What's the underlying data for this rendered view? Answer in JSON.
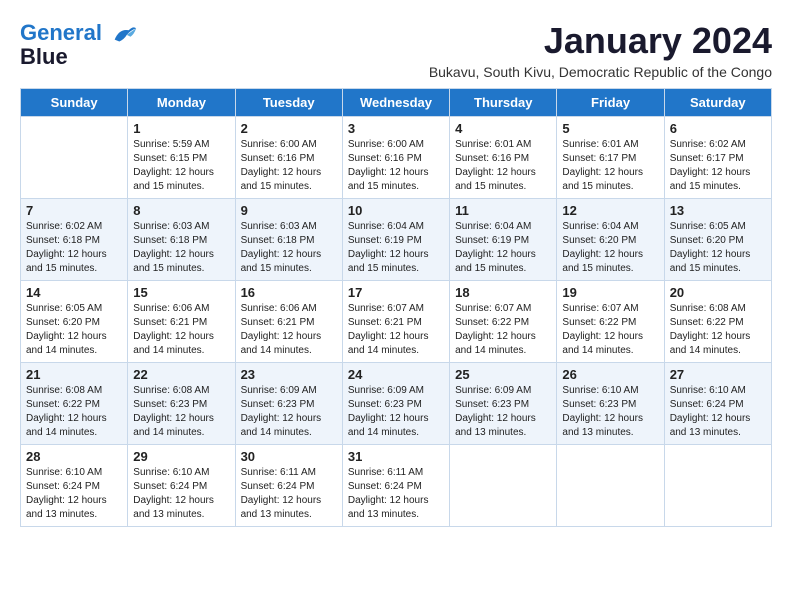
{
  "header": {
    "logo": {
      "line1": "General",
      "line2": "Blue"
    },
    "title": "January 2024",
    "subtitle": "Bukavu, South Kivu, Democratic Republic of the Congo"
  },
  "weekdays": [
    "Sunday",
    "Monday",
    "Tuesday",
    "Wednesday",
    "Thursday",
    "Friday",
    "Saturday"
  ],
  "weeks": [
    [
      {
        "day": "",
        "info": ""
      },
      {
        "day": "1",
        "info": "Sunrise: 5:59 AM\nSunset: 6:15 PM\nDaylight: 12 hours\nand 15 minutes."
      },
      {
        "day": "2",
        "info": "Sunrise: 6:00 AM\nSunset: 6:16 PM\nDaylight: 12 hours\nand 15 minutes."
      },
      {
        "day": "3",
        "info": "Sunrise: 6:00 AM\nSunset: 6:16 PM\nDaylight: 12 hours\nand 15 minutes."
      },
      {
        "day": "4",
        "info": "Sunrise: 6:01 AM\nSunset: 6:16 PM\nDaylight: 12 hours\nand 15 minutes."
      },
      {
        "day": "5",
        "info": "Sunrise: 6:01 AM\nSunset: 6:17 PM\nDaylight: 12 hours\nand 15 minutes."
      },
      {
        "day": "6",
        "info": "Sunrise: 6:02 AM\nSunset: 6:17 PM\nDaylight: 12 hours\nand 15 minutes."
      }
    ],
    [
      {
        "day": "7",
        "info": "Sunrise: 6:02 AM\nSunset: 6:18 PM\nDaylight: 12 hours\nand 15 minutes."
      },
      {
        "day": "8",
        "info": "Sunrise: 6:03 AM\nSunset: 6:18 PM\nDaylight: 12 hours\nand 15 minutes."
      },
      {
        "day": "9",
        "info": "Sunrise: 6:03 AM\nSunset: 6:18 PM\nDaylight: 12 hours\nand 15 minutes."
      },
      {
        "day": "10",
        "info": "Sunrise: 6:04 AM\nSunset: 6:19 PM\nDaylight: 12 hours\nand 15 minutes."
      },
      {
        "day": "11",
        "info": "Sunrise: 6:04 AM\nSunset: 6:19 PM\nDaylight: 12 hours\nand 15 minutes."
      },
      {
        "day": "12",
        "info": "Sunrise: 6:04 AM\nSunset: 6:20 PM\nDaylight: 12 hours\nand 15 minutes."
      },
      {
        "day": "13",
        "info": "Sunrise: 6:05 AM\nSunset: 6:20 PM\nDaylight: 12 hours\nand 15 minutes."
      }
    ],
    [
      {
        "day": "14",
        "info": "Sunrise: 6:05 AM\nSunset: 6:20 PM\nDaylight: 12 hours\nand 14 minutes."
      },
      {
        "day": "15",
        "info": "Sunrise: 6:06 AM\nSunset: 6:21 PM\nDaylight: 12 hours\nand 14 minutes."
      },
      {
        "day": "16",
        "info": "Sunrise: 6:06 AM\nSunset: 6:21 PM\nDaylight: 12 hours\nand 14 minutes."
      },
      {
        "day": "17",
        "info": "Sunrise: 6:07 AM\nSunset: 6:21 PM\nDaylight: 12 hours\nand 14 minutes."
      },
      {
        "day": "18",
        "info": "Sunrise: 6:07 AM\nSunset: 6:22 PM\nDaylight: 12 hours\nand 14 minutes."
      },
      {
        "day": "19",
        "info": "Sunrise: 6:07 AM\nSunset: 6:22 PM\nDaylight: 12 hours\nand 14 minutes."
      },
      {
        "day": "20",
        "info": "Sunrise: 6:08 AM\nSunset: 6:22 PM\nDaylight: 12 hours\nand 14 minutes."
      }
    ],
    [
      {
        "day": "21",
        "info": "Sunrise: 6:08 AM\nSunset: 6:22 PM\nDaylight: 12 hours\nand 14 minutes."
      },
      {
        "day": "22",
        "info": "Sunrise: 6:08 AM\nSunset: 6:23 PM\nDaylight: 12 hours\nand 14 minutes."
      },
      {
        "day": "23",
        "info": "Sunrise: 6:09 AM\nSunset: 6:23 PM\nDaylight: 12 hours\nand 14 minutes."
      },
      {
        "day": "24",
        "info": "Sunrise: 6:09 AM\nSunset: 6:23 PM\nDaylight: 12 hours\nand 14 minutes."
      },
      {
        "day": "25",
        "info": "Sunrise: 6:09 AM\nSunset: 6:23 PM\nDaylight: 12 hours\nand 13 minutes."
      },
      {
        "day": "26",
        "info": "Sunrise: 6:10 AM\nSunset: 6:23 PM\nDaylight: 12 hours\nand 13 minutes."
      },
      {
        "day": "27",
        "info": "Sunrise: 6:10 AM\nSunset: 6:24 PM\nDaylight: 12 hours\nand 13 minutes."
      }
    ],
    [
      {
        "day": "28",
        "info": "Sunrise: 6:10 AM\nSunset: 6:24 PM\nDaylight: 12 hours\nand 13 minutes."
      },
      {
        "day": "29",
        "info": "Sunrise: 6:10 AM\nSunset: 6:24 PM\nDaylight: 12 hours\nand 13 minutes."
      },
      {
        "day": "30",
        "info": "Sunrise: 6:11 AM\nSunset: 6:24 PM\nDaylight: 12 hours\nand 13 minutes."
      },
      {
        "day": "31",
        "info": "Sunrise: 6:11 AM\nSunset: 6:24 PM\nDaylight: 12 hours\nand 13 minutes."
      },
      {
        "day": "",
        "info": ""
      },
      {
        "day": "",
        "info": ""
      },
      {
        "day": "",
        "info": ""
      }
    ]
  ]
}
